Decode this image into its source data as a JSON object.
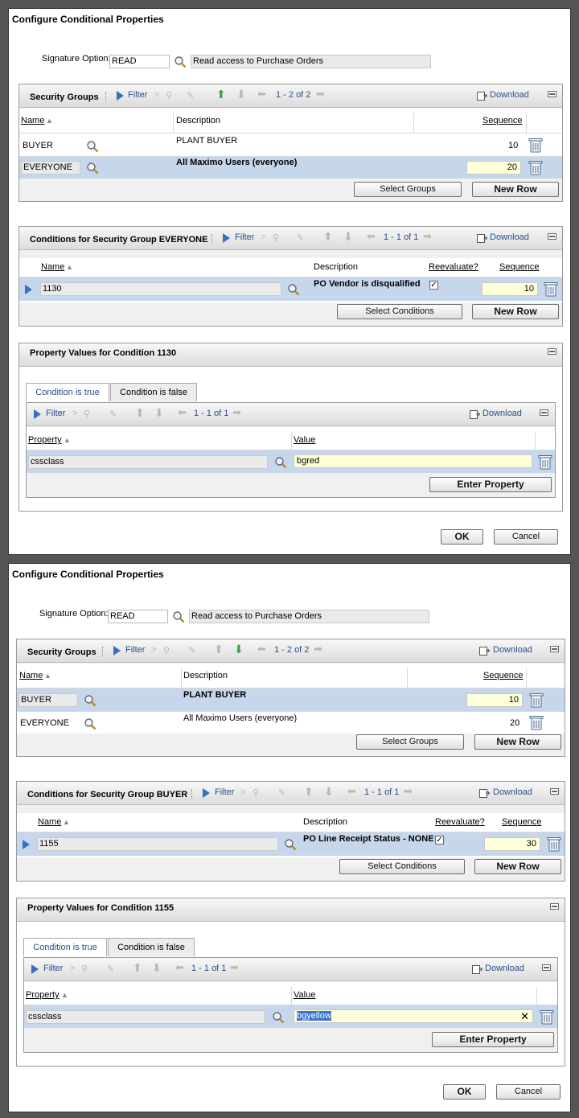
{
  "dialogs": [
    {
      "title": "Configure Conditional Properties",
      "signature": {
        "label": "Signature Option:",
        "value": "READ",
        "description": "Read access to Purchase Orders"
      },
      "security_groups": {
        "title": "Security Groups",
        "filter": "Filter",
        "pager": "1 - 2 of 2",
        "download": "Download",
        "columns": {
          "name": "Name",
          "description": "Description",
          "sequence": "Sequence"
        },
        "rows": [
          {
            "name": "BUYER",
            "description": "PLANT BUYER",
            "sequence": "10"
          },
          {
            "name": "EVERYONE",
            "description": "All Maximo Users (everyone)",
            "sequence": "20"
          }
        ],
        "select_button": "Select Groups",
        "new_row_button": "New Row"
      },
      "conditions": {
        "title": "Conditions for Security Group EVERYONE",
        "filter": "Filter",
        "pager": "1 - 1 of 1",
        "download": "Download",
        "columns": {
          "name": "Name",
          "description": "Description",
          "reevaluate": "Reevaluate?",
          "sequence": "Sequence"
        },
        "row": {
          "name": "1130",
          "description": "PO Vendor is disqualified",
          "reevaluate": true,
          "sequence": "10"
        },
        "select_button": "Select Conditions",
        "new_row_button": "New Row"
      },
      "property_values": {
        "title": "Property Values for Condition 1130",
        "tab_true": "Condition is true",
        "tab_false": "Condition is false",
        "filter": "Filter",
        "pager": "1 - 1 of 1",
        "download": "Download",
        "columns": {
          "property": "Property",
          "value": "Value"
        },
        "row": {
          "property": "cssclass",
          "value": "bgred"
        },
        "enter_button": "Enter Property"
      },
      "ok": "OK",
      "cancel": "Cancel"
    },
    {
      "title": "Configure Conditional Properties",
      "signature": {
        "label": "Signature Option:",
        "value": "READ",
        "description": "Read access to Purchase Orders"
      },
      "security_groups": {
        "title": "Security Groups",
        "filter": "Filter",
        "pager": "1 - 2 of 2",
        "download": "Download",
        "columns": {
          "name": "Name",
          "description": "Description",
          "sequence": "Sequence"
        },
        "rows": [
          {
            "name": "BUYER",
            "description": "PLANT BUYER",
            "sequence": "10"
          },
          {
            "name": "EVERYONE",
            "description": "All Maximo Users (everyone)",
            "sequence": "20"
          }
        ],
        "select_button": "Select Groups",
        "new_row_button": "New Row"
      },
      "conditions": {
        "title": "Conditions for Security Group BUYER",
        "filter": "Filter",
        "pager": "1 - 1 of 1",
        "download": "Download",
        "columns": {
          "name": "Name",
          "description": "Description",
          "reevaluate": "Reevaluate?",
          "sequence": "Sequence"
        },
        "row": {
          "name": "1155",
          "description": "PO Line Receipt Status - NONE",
          "reevaluate": true,
          "sequence": "30"
        },
        "select_button": "Select Conditions",
        "new_row_button": "New Row"
      },
      "property_values": {
        "title": "Property Values for Condition 1155",
        "tab_true": "Condition is true",
        "tab_false": "Condition is false",
        "filter": "Filter",
        "pager": "1 - 1 of 1",
        "download": "Download",
        "columns": {
          "property": "Property",
          "value": "Value"
        },
        "row": {
          "property": "cssclass",
          "value": "bgyellow"
        },
        "enter_button": "Enter Property"
      },
      "ok": "OK",
      "cancel": "Cancel"
    }
  ]
}
